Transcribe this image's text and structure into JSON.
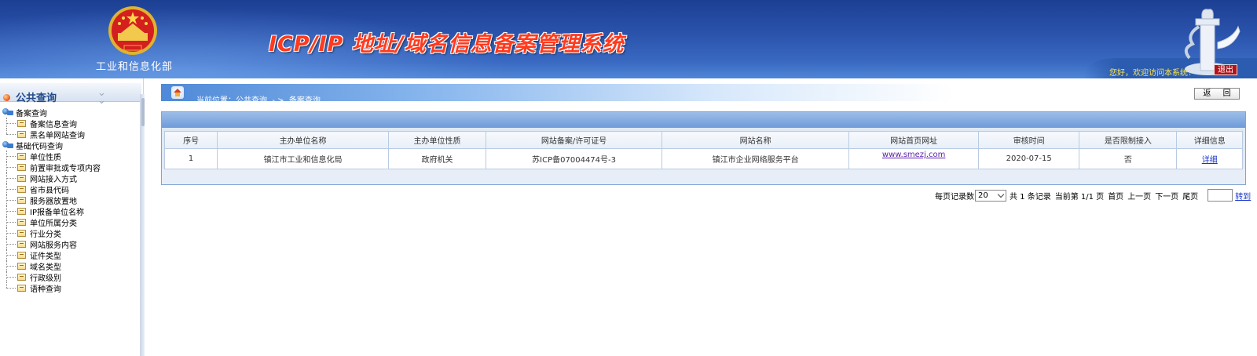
{
  "header": {
    "ministry": "工业和信息化部",
    "title": "ICP/IP 地址/域名信息备案管理系统",
    "welcome": "您好，欢迎访问本系统！",
    "logout": "退出"
  },
  "sidebar": {
    "title": "公共查询",
    "collapse_icon": "double-chevron-down-icon",
    "groups": [
      {
        "label": "备案查询",
        "items": [
          "备案信息查询",
          "黑名单网站查询"
        ]
      },
      {
        "label": "基础代码查询",
        "items": [
          "单位性质",
          "前置审批或专项内容",
          "网站接入方式",
          "省市县代码",
          "服务器放置地",
          "IP报备单位名称",
          "单位所属分类",
          "行业分类",
          "网站服务内容",
          "证件类型",
          "域名类型",
          "行政级别",
          "语种查询"
        ]
      }
    ]
  },
  "location": {
    "text": "当前位置：公共查询  - >  备案查询"
  },
  "back_button": "返 回",
  "table": {
    "headers": [
      "序号",
      "主办单位名称",
      "主办单位性质",
      "网站备案/许可证号",
      "网站名称",
      "网站首页网址",
      "审核时间",
      "是否限制接入",
      "详细信息"
    ],
    "rows": [
      [
        "1",
        "镇江市工业和信息化局",
        "政府机关",
        "苏ICP备07004474号-3",
        "镇江市企业网络服务平台",
        "www.smezj.com",
        "2020-07-15",
        "否",
        "详细"
      ]
    ]
  },
  "pager": {
    "per_page_label": "每页记录数",
    "per_page_value": "20",
    "total": "共 1 条记录",
    "current": "当前第 1/1 页",
    "first": "首页",
    "prev": "上一页",
    "next": "下一页",
    "last": "尾页",
    "goto": "转到"
  },
  "colors": {
    "header_blue": "#2b54ad",
    "title_red": "#ff3a1e",
    "logout_red": "#b3121a",
    "welcome_yellow": "#ffe74a"
  }
}
